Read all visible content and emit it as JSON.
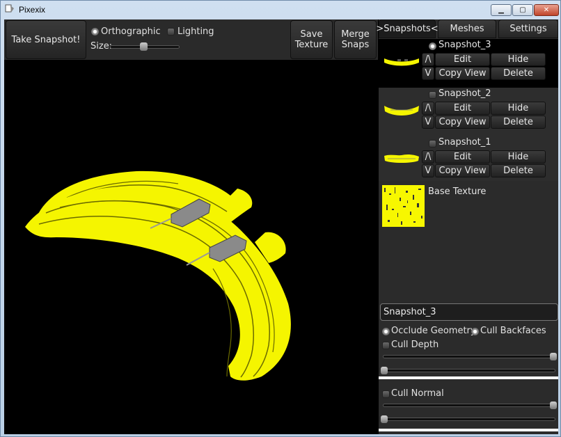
{
  "window": {
    "title": "Pixexix",
    "min_glyph": "▁",
    "max_glyph": "▢",
    "close_glyph": "✕"
  },
  "toolbar": {
    "take_snapshot": "Take Snapshot!",
    "orthographic": "Orthographic",
    "orthographic_checked": true,
    "lighting": "Lighting",
    "lighting_checked": false,
    "size_label": "Size:",
    "size_value": 0.45,
    "save_texture": "Save\nTexture",
    "merge_snaps": "Merge\nSnaps"
  },
  "tabs": [
    {
      "label": ">Snapshots<",
      "active": true
    },
    {
      "label": "Meshes",
      "active": false
    },
    {
      "label": "Settings",
      "active": false
    }
  ],
  "snapshots": [
    {
      "name": "Snapshot_3",
      "selected": true,
      "up": "/\\",
      "down": "V",
      "edit": "Edit",
      "hide": "Hide",
      "copy_view": "Copy View",
      "delete": "Delete"
    },
    {
      "name": "Snapshot_2",
      "selected": false,
      "up": "/\\",
      "down": "V",
      "edit": "Edit",
      "hide": "Hide",
      "copy_view": "Copy View",
      "delete": "Delete"
    },
    {
      "name": "Snapshot_1",
      "selected": false,
      "up": "/\\",
      "down": "V",
      "edit": "Edit",
      "hide": "Hide",
      "copy_view": "Copy View",
      "delete": "Delete"
    }
  ],
  "base_texture": {
    "label": "Base Texture"
  },
  "settings": {
    "name_value": "Snapshot_3",
    "occlude_geometry": "Occlude Geometry",
    "occlude_checked": true,
    "cull_backfaces": "Cull Backfaces",
    "cull_backfaces_checked": true,
    "cull_depth": "Cull Depth",
    "cull_depth_checked": false,
    "cull_depth_max": 1.0,
    "cull_depth_min": 0.0,
    "cull_normal": "Cull Normal",
    "cull_normal_checked": false,
    "cull_normal_max": 1.0,
    "cull_normal_min": 0.0
  },
  "colors": {
    "banana": "#f5f500",
    "panel": "#2b2b2b",
    "accent": "#e6e6e6"
  }
}
